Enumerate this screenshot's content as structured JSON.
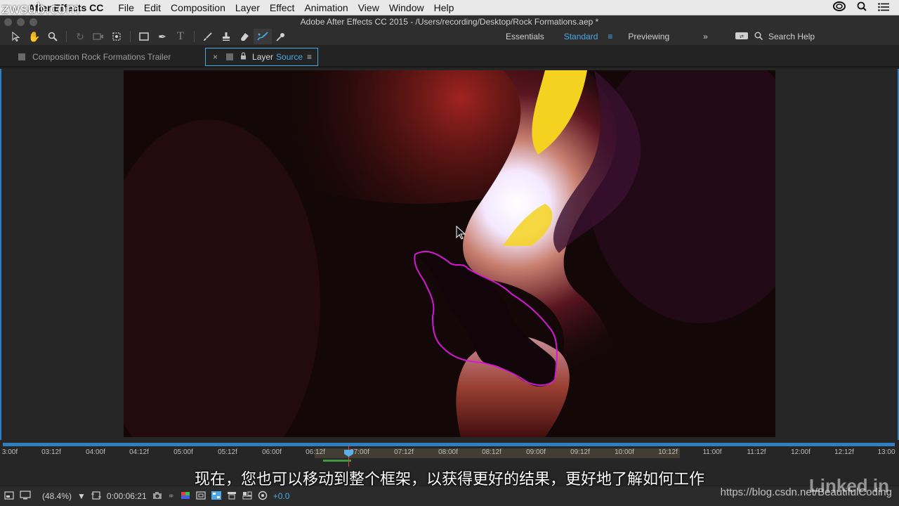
{
  "menubar": {
    "app_name": "After Effects CC",
    "items": [
      "File",
      "Edit",
      "Composition",
      "Layer",
      "Effect",
      "Animation",
      "View",
      "Window",
      "Help"
    ]
  },
  "window": {
    "title": "Adobe After Effects CC 2015 - /Users/recording/Desktop/Rock Formations.aep *"
  },
  "workspaces": {
    "items": [
      "Essentials",
      "Standard",
      "Previewing"
    ],
    "current": "Standard",
    "search_label": "Search Help"
  },
  "tabs": {
    "composition": "Composition Rock Formations Trailer",
    "layer_prefix": "Layer",
    "layer_name": "Source"
  },
  "timeline": {
    "ticks": [
      "3:00f",
      "03:12f",
      "04:00f",
      "04:12f",
      "05:00f",
      "05:12f",
      "06:00f",
      "06:12f",
      "07:00f",
      "07:12f",
      "08:00f",
      "08:12f",
      "09:00f",
      "09:12f",
      "10:00f",
      "10:12f",
      "11:00f",
      "11:12f",
      "12:00f",
      "12:12f",
      "13:00"
    ]
  },
  "statusbar": {
    "zoom": "(48.4%)",
    "timecode": "0:00:06:21",
    "exposure": "+0.0"
  },
  "overlay": {
    "subtitle": "现在，您也可以移动到整个框架，以获得更好的结果，更好地了解如何工作",
    "watermark_top": "zwsub.com",
    "watermark_url": "https://blog.csdn.net/BeautifulCoding",
    "logo": "Linked in"
  },
  "colors": {
    "accent": "#4aa9e6",
    "mask_path": "#d21ad2",
    "panel_border": "#2f7fc1"
  }
}
